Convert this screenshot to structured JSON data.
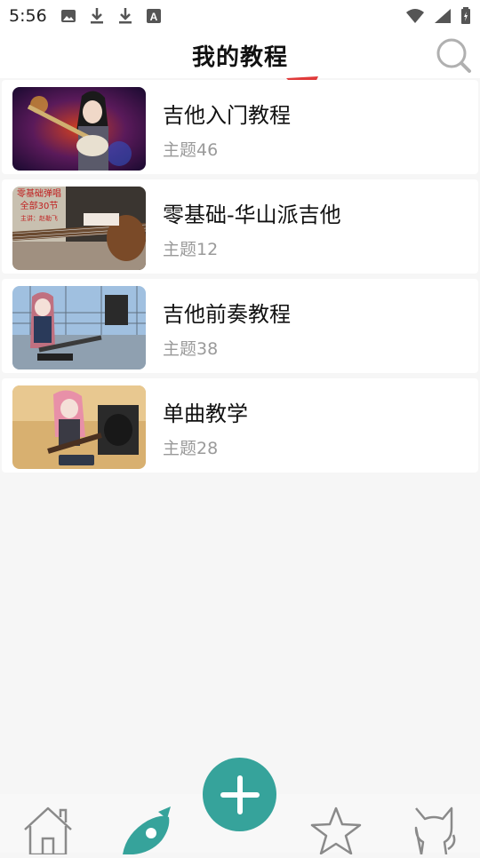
{
  "status": {
    "time": "5:56"
  },
  "header": {
    "title": "我的教程"
  },
  "courses": [
    {
      "title": "吉他入门教程",
      "subtitle": "主题46"
    },
    {
      "title": "零基础-华山派吉他",
      "subtitle": "主题12",
      "thumb_text": [
        "零基础弹唱",
        "全部30节",
        "主讲：赵勒飞"
      ]
    },
    {
      "title": "吉他前奏教程",
      "subtitle": "主题38"
    },
    {
      "title": "单曲教学",
      "subtitle": "主题28"
    }
  ],
  "bottom_nav": {
    "icons": [
      "home-icon",
      "rocket-icon",
      "add-icon",
      "star-icon",
      "cat-icon"
    ],
    "fab_color": "#36a39b",
    "active_color": "#36a39b"
  }
}
